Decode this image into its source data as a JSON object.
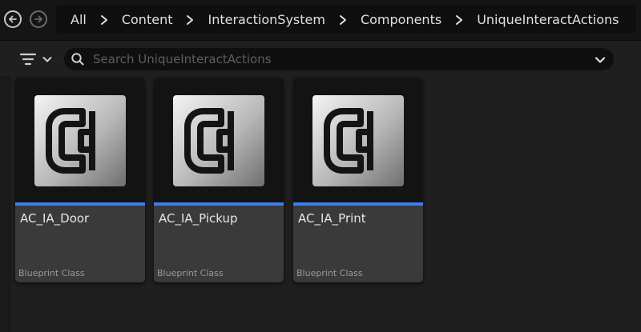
{
  "breadcrumbs": [
    "All",
    "Content",
    "InteractionSystem",
    "Components",
    "UniqueInteractActions"
  ],
  "search": {
    "placeholder": "Search UniqueInteractActions",
    "value": ""
  },
  "assets": [
    {
      "name": "AC_IA_Door",
      "type": "Blueprint Class",
      "icon": "blueprint-component-icon"
    },
    {
      "name": "AC_IA_Pickup",
      "type": "Blueprint Class",
      "icon": "blueprint-component-icon"
    },
    {
      "name": "AC_IA_Print",
      "type": "Blueprint Class",
      "icon": "blueprint-component-icon"
    }
  ],
  "icons": {
    "back": "arrow-left-icon",
    "forward": "arrow-right-icon",
    "filter": "filter-icon",
    "search": "search-icon",
    "dropdown": "chevron-down-icon"
  },
  "colors": {
    "accent": "#3d7ef0",
    "background": "#1f1f1f",
    "tile": "#3a3a3a"
  }
}
